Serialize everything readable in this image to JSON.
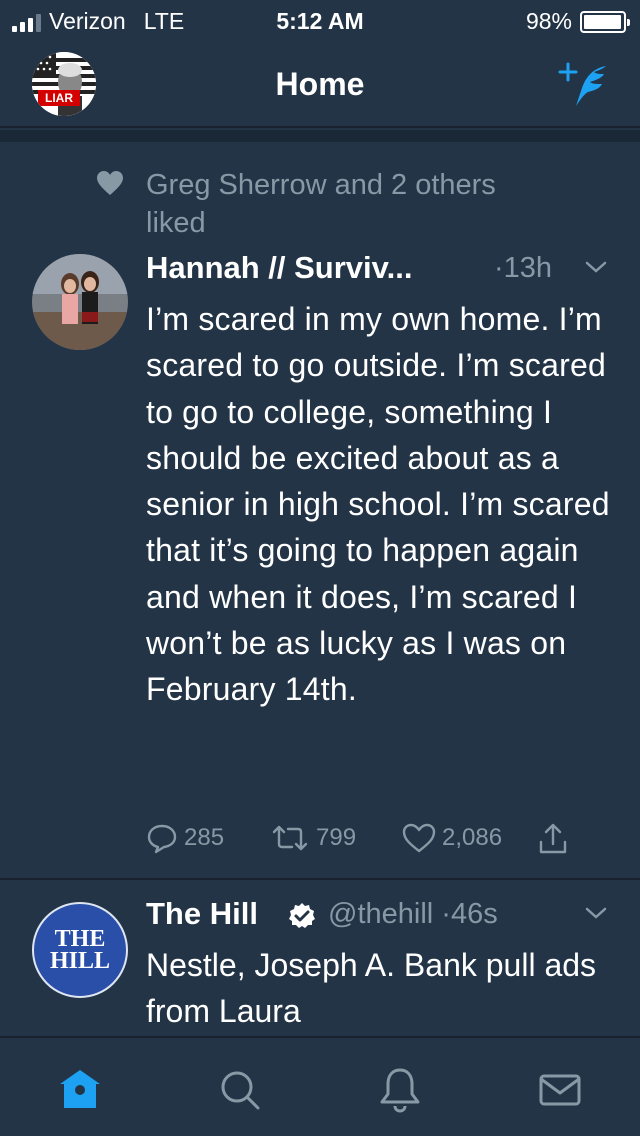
{
  "status_bar": {
    "carrier": "Verizon",
    "network": "LTE",
    "time": "5:12 AM",
    "battery_percent": "98%",
    "battery_level": 0.98,
    "signal_bars": 3
  },
  "nav": {
    "title": "Home",
    "avatar_badge": "LIAR"
  },
  "tweets": [
    {
      "social_context": "Greg Sherrow and 2 others liked",
      "author": "Hannah // Surviv...",
      "time": "13h",
      "text": "I’m scared in my own home. I’m scared to go outside. I’m scared to go to college, something I should be excited about as a senior in high school. I’m scared that it’s going to happen again and when it does, I’m scared I won’t be as lucky as I was on February 14th.",
      "replies": "285",
      "retweets": "799",
      "likes": "2,086"
    },
    {
      "author": "The Hill",
      "verified": true,
      "handle": "@thehill",
      "time": "46s",
      "avatar_text_line1": "THE",
      "avatar_text_line2": "HILL",
      "text": "Nestle, Joseph A. Bank pull ads from Laura"
    }
  ],
  "tab_bar": {
    "items": [
      {
        "icon": "home-icon",
        "active": true
      },
      {
        "icon": "search-icon",
        "active": false
      },
      {
        "icon": "bell-icon",
        "active": false
      },
      {
        "icon": "mail-icon",
        "active": false
      }
    ]
  },
  "colors": {
    "background": "#243447",
    "accent": "#1da1f2",
    "muted": "#8899a6"
  }
}
